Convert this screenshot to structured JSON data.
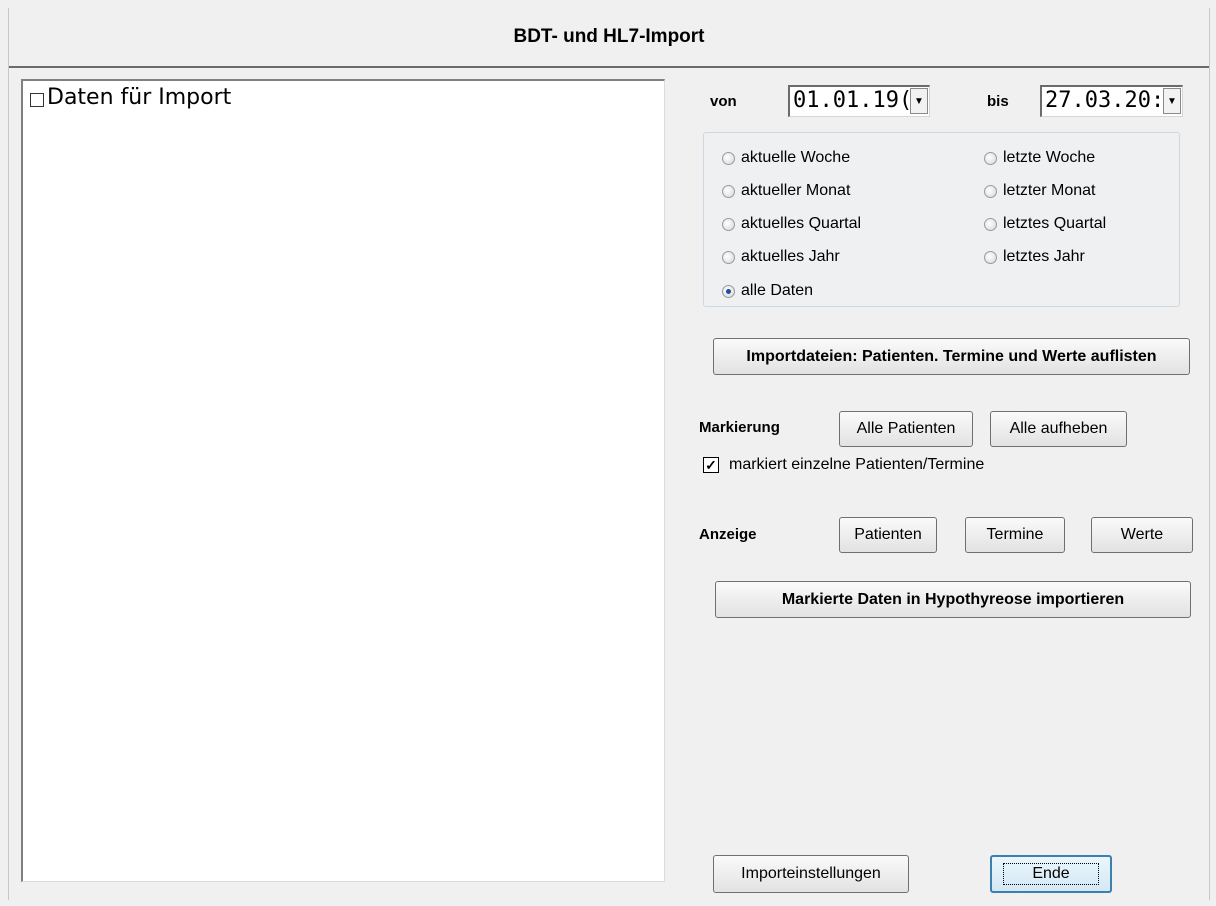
{
  "window": {
    "title": "BDT- und HL7-Import"
  },
  "tree": {
    "root_label": "Daten für Import"
  },
  "daterange": {
    "from_label": "von",
    "from_value": "01.01.19(",
    "to_label": "bis",
    "to_value": "27.03.20:"
  },
  "radios": {
    "current_week": "aktuelle Woche",
    "last_week": "letzte Woche",
    "current_month": "aktueller Monat",
    "last_month": "letzter Monat",
    "current_quarter": "aktuelles Quartal",
    "last_quarter": "letztes Quartal",
    "current_year": "aktuelles Jahr",
    "last_year": "letztes Jahr",
    "all_data": "alle Daten",
    "selected": "all_data"
  },
  "actions": {
    "list_files": "Importdateien: Patienten. Termine und Werte auflisten",
    "marking_label": "Markierung",
    "all_patients": "Alle Patienten",
    "clear_all": "Alle aufheben",
    "mark_individual": "markiert einzelne Patienten/Termine",
    "mark_individual_checked": true,
    "display_label": "Anzeige",
    "patients": "Patienten",
    "appointments": "Termine",
    "values": "Werte",
    "import_marked": "Markierte Daten in Hypothyreose importieren",
    "settings": "Importeinstellungen",
    "end": "Ende"
  },
  "colors": {
    "focus_border": "#3c7fb1",
    "radio_selected": "#1a4fa0"
  },
  "icons": {
    "dropdown": "chevron-down-icon",
    "check": "checkmark-icon"
  }
}
